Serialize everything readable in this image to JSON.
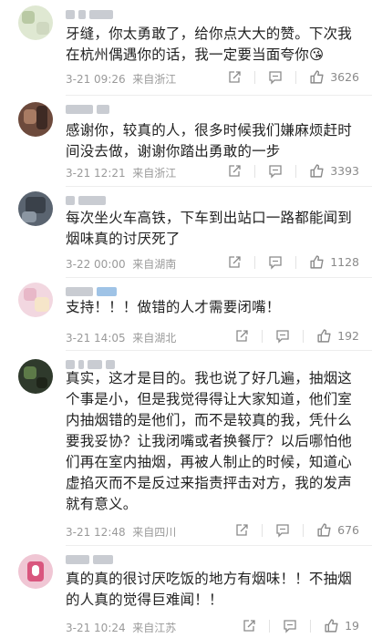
{
  "comments": [
    {
      "text": "牙缝，你太勇敢了，给你点大大的赞。下次我在杭州偶遇你的话，我一定要当面夸你😘",
      "time": "3-21 09:26",
      "location": "来自浙江",
      "likes": "3626"
    },
    {
      "text": "感谢你，较真的人，很多时候我们嫌麻烦赶时间没去做，谢谢你踏出勇敢的一步",
      "time": "3-21 12:21",
      "location": "来自浙江",
      "likes": "3393"
    },
    {
      "text": "每次坐火车高铁，下车到出站口一路都能闻到烟味真的讨厌死了",
      "time": "3-22 00:00",
      "location": "来自湖南",
      "likes": "1128"
    },
    {
      "text": "支持！！！做错的人才需要闭嘴！",
      "time": "3-21 14:05",
      "location": "来自湖北",
      "likes": "192"
    },
    {
      "text": "真实，这才是目的。我也说了好几遍，抽烟这个事是小，但是我觉得得让大家知道，他们室内抽烟错的是他们，而不是较真的我，凭什么要我妥协？让我闭嘴或者换餐厅？以后哪怕他们再在室内抽烟，再被人制止的时候，知道心虚掐灭而不是反过来指责抨击对方，我的发声就有意义。",
      "time": "3-21 12:48",
      "location": "来自四川",
      "likes": "676"
    },
    {
      "text": "真的真的很讨厌吃饭的地方有烟味！！不抽烟的人真的觉得巨难闻！！",
      "time": "3-21 10:24",
      "location": "来自江苏",
      "likes": "19"
    }
  ],
  "colors": {
    "text": "#222222",
    "meta": "#9a9a9a",
    "icon": "#8a8a8a"
  },
  "icons": [
    "share-icon",
    "comment-icon",
    "like-icon"
  ]
}
